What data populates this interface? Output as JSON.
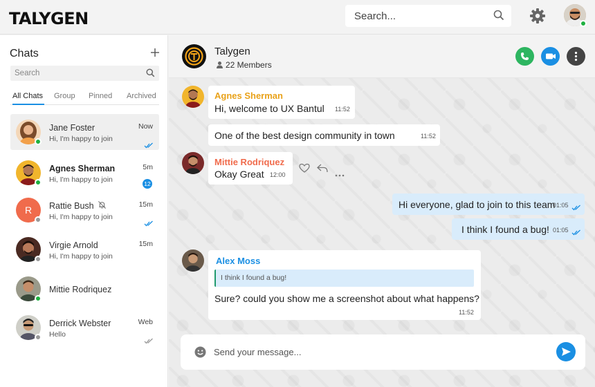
{
  "app": {
    "logo_text": "TALYGEN"
  },
  "topbar": {
    "search_placeholder": "Search..."
  },
  "sidebar": {
    "title": "Chats",
    "search_placeholder": "Search",
    "tabs": [
      {
        "label": "All Chats",
        "active": true
      },
      {
        "label": "Group",
        "active": false
      },
      {
        "label": "Pinned",
        "active": false
      },
      {
        "label": "Archived",
        "active": false
      }
    ],
    "chats": [
      {
        "name": "Jane Foster",
        "preview": "Hi, I'm happy to join",
        "time": "Now",
        "status": "online",
        "indicator": "double-check"
      },
      {
        "name": "Agnes Sherman",
        "preview": "Hi, I'm happy to join",
        "time": "5m",
        "status": "online",
        "unread": "12"
      },
      {
        "name": "Rattie Bush",
        "initial": "R",
        "preview": "Hi, I'm happy to join",
        "time": "15m",
        "status": "away",
        "muted": true,
        "indicator": "double-check"
      },
      {
        "name": "Virgie Arnold",
        "preview": "Hi, I'm happy to join",
        "time": "15m",
        "status": "away"
      },
      {
        "name": "Mittie Rodriquez",
        "status": "online"
      },
      {
        "name": "Derrick Webster",
        "preview": "Hello",
        "time": "Web",
        "status": "away",
        "indicator": "double-check-gray"
      }
    ]
  },
  "chat": {
    "group_name": "Talygen",
    "members": "22 Members",
    "messages": [
      {
        "sender": "Agnes Sherman",
        "sender_color": "#e9a21a",
        "text": "Hi, welcome to UX Bantul",
        "time": "11:52"
      },
      {
        "text": "One of the best design community in town",
        "time": "11:52"
      },
      {
        "sender": "Mittie Rodriquez",
        "sender_color": "#f06b4c",
        "text": "Okay Great",
        "time": "12:00"
      },
      {
        "text": "Hi everyone, glad to join to this team",
        "time": "01:05",
        "outgoing": true
      },
      {
        "text": "I think I found a bug!",
        "time": "01:05",
        "outgoing": true
      },
      {
        "sender": "Alex Moss",
        "sender_color": "#1a8fe3",
        "quote": "I think I found a bug!",
        "text": "Sure? could you show me a screenshot about what happens?",
        "time": "11:52"
      }
    ],
    "composer_placeholder": "Send your message..."
  },
  "colors": {
    "accent": "#1a8fe3",
    "online": "#1fb141",
    "call": "#2db560",
    "video": "#1a8fe3",
    "menu": "#444444"
  }
}
